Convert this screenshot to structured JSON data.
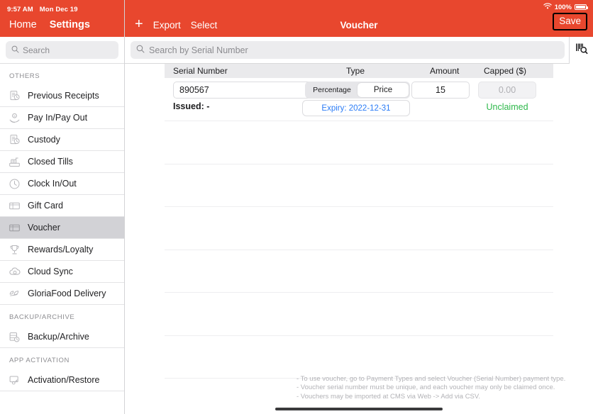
{
  "status": {
    "time": "9:57 AM",
    "date": "Mon Dec 19",
    "wifi_icon": "wifi-icon",
    "battery_percent": "100%"
  },
  "sidebar": {
    "nav": {
      "home": "Home",
      "settings": "Settings"
    },
    "search": {
      "placeholder": "Search",
      "value": "",
      "icon": "search-icon"
    },
    "sections": [
      {
        "title": "OTHERS",
        "items": [
          {
            "label": "Previous Receipts",
            "icon": "receipt-clock-icon",
            "selected": false
          },
          {
            "label": "Pay In/Pay Out",
            "icon": "hand-coin-icon",
            "selected": false
          },
          {
            "label": "Custody",
            "icon": "receipt-clock-icon",
            "selected": false
          },
          {
            "label": "Closed Tills",
            "icon": "cash-register-icon",
            "selected": false
          },
          {
            "label": "Clock In/Out",
            "icon": "clock-icon",
            "selected": false
          },
          {
            "label": "Gift Card",
            "icon": "card-icon",
            "selected": false
          },
          {
            "label": "Voucher",
            "icon": "card-icon",
            "selected": true
          },
          {
            "label": "Rewards/Loyalty",
            "icon": "trophy-icon",
            "selected": false
          },
          {
            "label": "Cloud Sync",
            "icon": "cloud-sync-icon",
            "selected": false
          },
          {
            "label": "GloriaFood Delivery",
            "icon": "leaf-icon",
            "selected": false
          }
        ]
      },
      {
        "title": "BACKUP/ARCHIVE",
        "items": [
          {
            "label": "Backup/Archive",
            "icon": "database-clock-icon",
            "selected": false
          }
        ]
      },
      {
        "title": "APP ACTIVATION",
        "items": [
          {
            "label": "Activation/Restore",
            "icon": "device-key-icon",
            "selected": false
          }
        ]
      }
    ]
  },
  "topbar": {
    "add_icon": "plus-icon",
    "export_label": "Export",
    "select_label": "Select",
    "title": "Voucher",
    "save_label": "Save"
  },
  "search": {
    "placeholder": "Search by Serial Number",
    "value": "",
    "icon": "search-icon",
    "scan_icon": "barcode-scan-icon"
  },
  "table": {
    "columns": [
      "Serial Number",
      "Type",
      "Amount",
      "Capped ($)"
    ],
    "rows": [
      {
        "serial": "890567",
        "type_options": [
          "Percentage",
          "Price"
        ],
        "type_selected": "Price",
        "amount": "15",
        "capped": "0.00",
        "capped_disabled": true,
        "issued": "Issued: -",
        "expiry": "Expiry: 2022-12-31",
        "claim_status": "Unclaimed"
      }
    ],
    "empty_row_count": 6
  },
  "notes": [
    "- To use voucher, go to Payment Types and select Voucher (Serial Number) payment type.",
    "- Voucher serial number must be unique, and each voucher may only be claimed once.",
    "- Vouchers may be imported at CMS via Web -> Add via CSV."
  ],
  "colors": {
    "accent": "#e8472e",
    "link": "#2b7cf6",
    "success": "#2eb84b",
    "selected_row": "#d2d2d6"
  }
}
